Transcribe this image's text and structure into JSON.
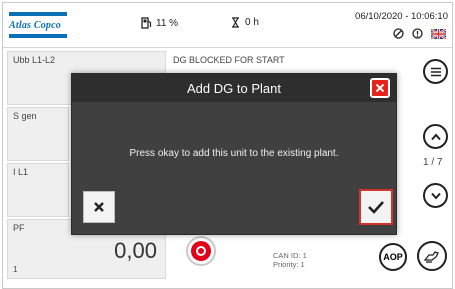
{
  "header": {
    "logo_text": "Atlas Copco",
    "fuel_value": "11 %",
    "hours_value": "0 h",
    "datetime": "06/10/2020 - 10:06:10"
  },
  "tiles": {
    "ubb_label": "Ubb L1-L2",
    "sgen_label": "S gen",
    "i_label": "I L1",
    "pf_label": "PF",
    "pf_value": "0,00",
    "pf_sub": "1"
  },
  "status": {
    "blocked_text": "DG BLOCKED FOR START",
    "can_id": "CAN ID: 1",
    "priority": "Priority: 1"
  },
  "nav": {
    "page_indicator": "1 / 7",
    "aop_label": "AOP"
  },
  "dialog": {
    "title": "Add DG to Plant",
    "message": "Press okay to add this unit to the existing plant."
  },
  "colors": {
    "brand_blue": "#0b70b8",
    "close_red": "#e5231b",
    "stop_red": "#e2001a",
    "dialog_bg": "#404040"
  },
  "icons": [
    "fuel-pump-icon",
    "hourglass-icon",
    "no-entry-icon",
    "info-icon",
    "uk-flag-icon",
    "menu-icon",
    "chevron-up-icon",
    "chevron-down-icon",
    "stop-icon",
    "hands-icon",
    "close-icon",
    "cancel-icon",
    "check-icon"
  ]
}
